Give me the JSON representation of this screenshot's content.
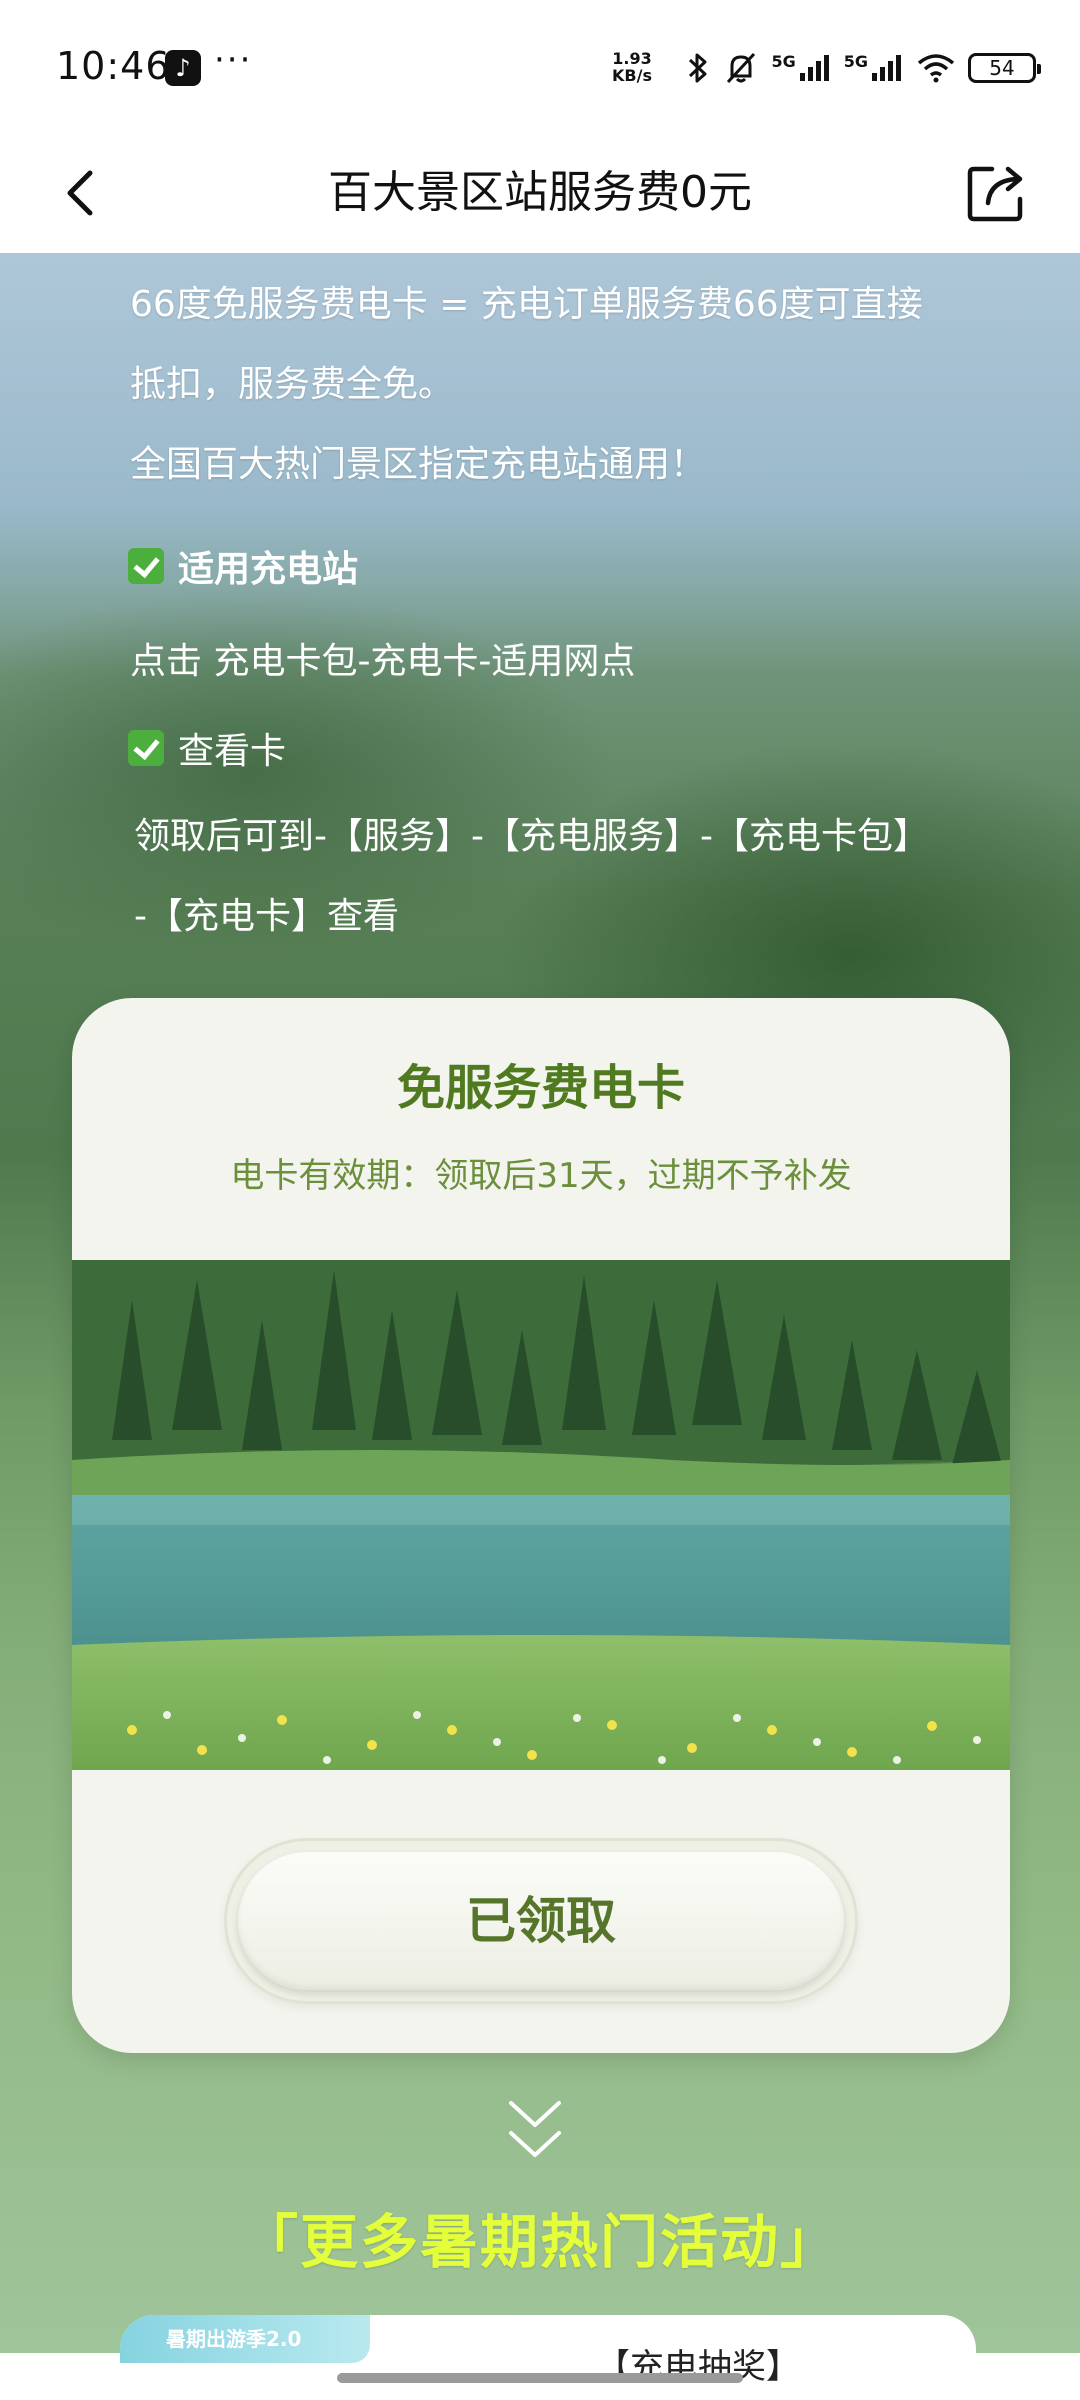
{
  "status_bar": {
    "time": "10:46",
    "app_icon": "tiktok-icon",
    "more": "···",
    "net_speed_value": "1.93",
    "net_speed_unit": "KB/s",
    "signal_1_label": "5G",
    "signal_2_label": "5G",
    "battery": "54"
  },
  "nav": {
    "title": "百大景区站服务费0元",
    "back_icon": "chevron-left-icon",
    "share_icon": "share-icon"
  },
  "intro": {
    "line1": "66度免服务费电卡 = 充电订单服务费66度可直接",
    "line2": "抵扣，服务费全免。",
    "line3": "全国百大热门景区指定充电站通用！"
  },
  "stations": {
    "heading": "适用充电站",
    "detail": "点击 充电卡包-充电卡-适用网点"
  },
  "view_card": {
    "heading": "查看卡",
    "detail_line1": "领取后可到-【服务】-【充电服务】-【充电卡包】",
    "detail_line2": "-【充电卡】查看"
  },
  "card": {
    "title": "免服务费电卡",
    "subtitle": "电卡有效期：领取后31天，过期不予补发",
    "button_label": "已领取"
  },
  "more": {
    "heading": "「更多暑期热门活动」"
  },
  "promo": {
    "tag": "暑期出游季2.0",
    "title": "【充电抽奖】"
  },
  "colors": {
    "accent_green": "#4f7a1f",
    "highlight_yellow": "#e4ff3a",
    "check_green": "#4caf3d"
  }
}
